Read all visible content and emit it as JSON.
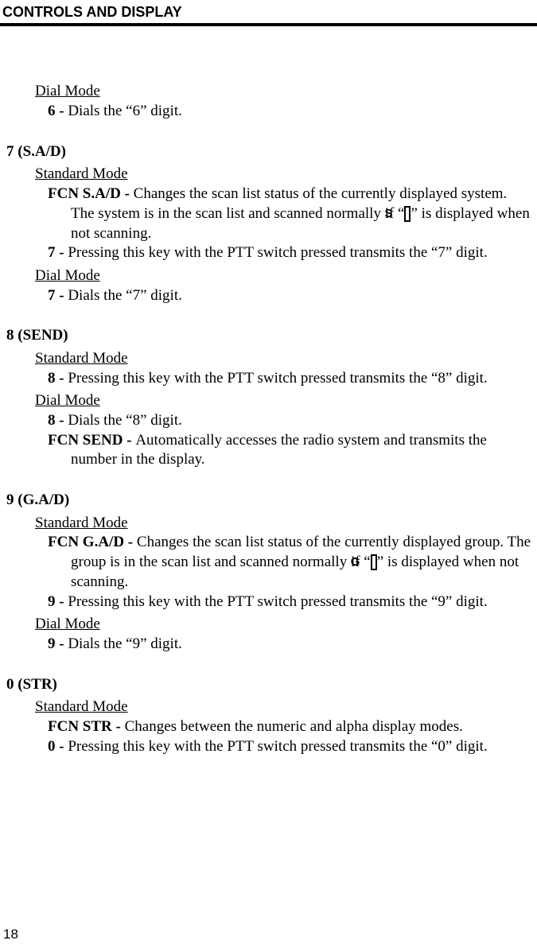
{
  "header": "CONTROLS AND DISPLAY",
  "page_number": "18",
  "top_block": {
    "mode": "Dial Mode",
    "item_label": "6 - ",
    "item_text": "Dials the “6” digit."
  },
  "sections": [
    {
      "heading": "7 (S.A/D)",
      "groups": [
        {
          "mode": "Standard Mode",
          "items": [
            {
              "label": "FCN S.A/D - ",
              "type": "fcn_s",
              "pre": "Changes the scan list status of the currently displayed system. The system is in the scan list and scanned normally if “",
              "post": "” is displayed when not scanning.",
              "box": "S"
            },
            {
              "label": "7 - ",
              "text": "Pressing this key with the PTT switch pressed transmits the “7” digit."
            }
          ]
        },
        {
          "mode": "Dial Mode",
          "items": [
            {
              "label": "7 - ",
              "text": "Dials the “7” digit."
            }
          ]
        }
      ]
    },
    {
      "heading": "8 (SEND)",
      "groups": [
        {
          "mode": "Standard Mode",
          "items": [
            {
              "label": "8 - ",
              "text": "Pressing this key with the PTT switch pressed transmits the “8” digit."
            }
          ]
        },
        {
          "mode": "Dial Mode",
          "items": [
            {
              "label": "8 - ",
              "text": "Dials the “8” digit."
            },
            {
              "label": "FCN SEND - ",
              "text": "Automatically accesses the radio system and transmits the number in the display."
            }
          ]
        }
      ]
    },
    {
      "heading": "9 (G.A/D)",
      "groups": [
        {
          "mode": "Standard Mode",
          "items": [
            {
              "label": "FCN G.A/D - ",
              "type": "fcn_g",
              "pre": "Changes the scan list status of the currently displayed group. The group is in the scan list and scanned normally if “",
              "post": "” is displayed when not scanning.",
              "box": "G"
            },
            {
              "label": "9 - ",
              "text": "Pressing this key with the PTT switch pressed transmits the “9” digit."
            }
          ]
        },
        {
          "mode": "Dial Mode",
          "items": [
            {
              "label": "9 - ",
              "text": "Dials the “9” digit."
            }
          ]
        }
      ]
    },
    {
      "heading": "0 (STR)",
      "groups": [
        {
          "mode": "Standard Mode",
          "items": [
            {
              "label": "FCN STR - ",
              "text": "Changes between the numeric and alpha display modes."
            },
            {
              "label": "0 - ",
              "text": "Pressing this key with the PTT switch pressed transmits the “0” digit."
            }
          ]
        }
      ]
    }
  ]
}
